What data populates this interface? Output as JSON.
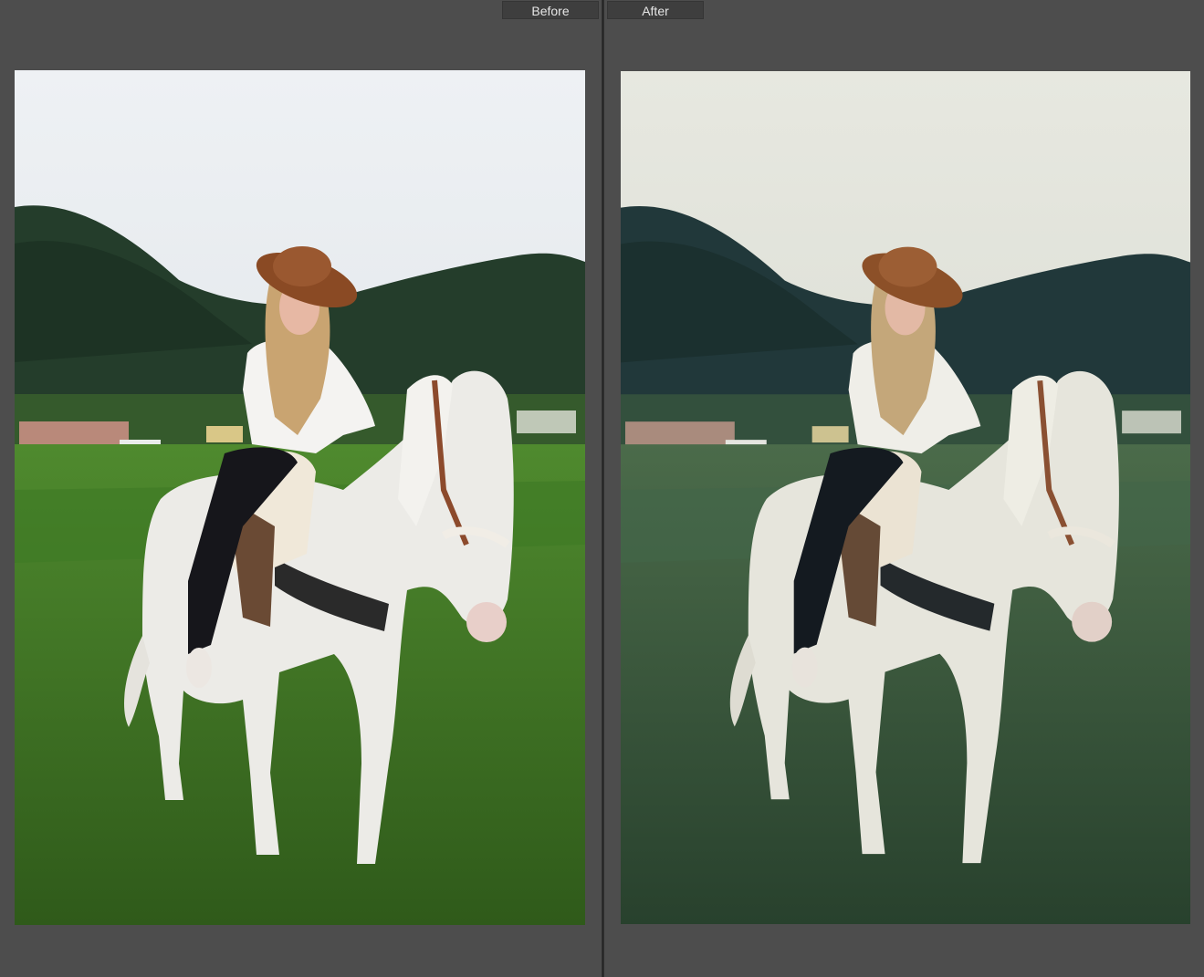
{
  "compare": {
    "before_label": "Before",
    "after_label": "After"
  },
  "images": {
    "before": {
      "subject": "woman-on-white-horse-before"
    },
    "after": {
      "subject": "woman-on-white-horse-after"
    }
  },
  "colors": {
    "background": "#4d4d4d",
    "label_bg": "#3e3e3e",
    "label_text": "#e6e6e6"
  }
}
